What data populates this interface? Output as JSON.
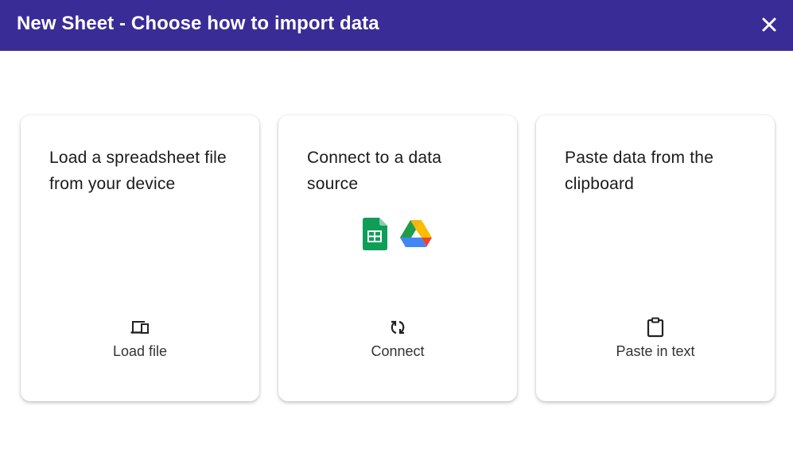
{
  "header": {
    "title": "New Sheet - Choose how to import data",
    "background": "#3a2c97",
    "close_icon": "close-icon"
  },
  "cards": [
    {
      "description": "Load a spreadsheet file from your device",
      "action_label": "Load file",
      "icon": "devices-icon"
    },
    {
      "description": "Connect to a data source",
      "action_label": "Connect",
      "icon": "sync-icon",
      "logos": [
        "google-sheets-icon",
        "google-drive-icon"
      ]
    },
    {
      "description": "Paste data from the clipboard",
      "action_label": "Paste in text",
      "icon": "clipboard-icon"
    }
  ]
}
